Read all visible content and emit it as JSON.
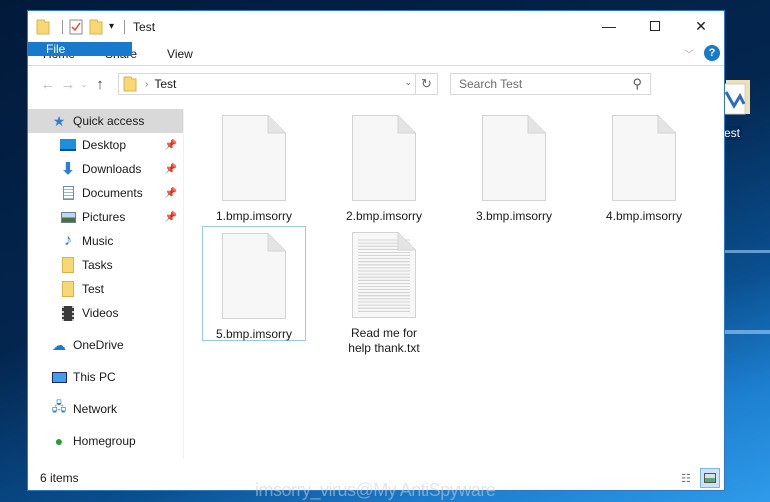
{
  "window": {
    "title": "Test"
  },
  "ribbon": {
    "tabs": [
      "File",
      "Home",
      "Share",
      "View"
    ]
  },
  "address": {
    "crumb": "Test",
    "search_placeholder": "Search Test"
  },
  "sidebar": {
    "quick_access": "Quick access",
    "items": [
      {
        "label": "Desktop",
        "pinned": true
      },
      {
        "label": "Downloads",
        "pinned": true
      },
      {
        "label": "Documents",
        "pinned": true
      },
      {
        "label": "Pictures",
        "pinned": true
      },
      {
        "label": "Music",
        "pinned": false
      },
      {
        "label": "Tasks",
        "pinned": false
      },
      {
        "label": "Test",
        "pinned": false
      },
      {
        "label": "Videos",
        "pinned": false
      }
    ],
    "roots": [
      "OneDrive",
      "This PC",
      "Network",
      "Homegroup"
    ]
  },
  "files": [
    {
      "name": "1.bmp.imsorry",
      "type": "blank"
    },
    {
      "name": "2.bmp.imsorry",
      "type": "blank"
    },
    {
      "name": "3.bmp.imsorry",
      "type": "blank"
    },
    {
      "name": "4.bmp.imsorry",
      "type": "blank"
    },
    {
      "name": "5.bmp.imsorry",
      "type": "blank",
      "selected": true
    },
    {
      "name": "Read me for help thank.txt",
      "type": "text"
    }
  ],
  "status": {
    "items": "6 items"
  },
  "desktop": {
    "icon_label": "est"
  },
  "watermark": "imsorry_virus@My AntiSpyware",
  "colors": {
    "accent": "#1979ca",
    "folder": "#f8d775",
    "selection": "#99c9ef"
  }
}
